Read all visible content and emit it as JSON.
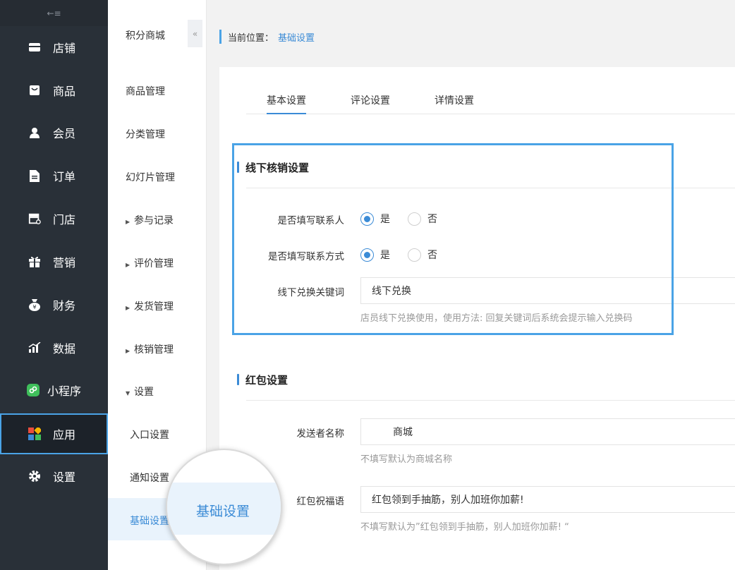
{
  "sidebar": {
    "toggle_icon": "←≡",
    "items": [
      {
        "label": "店铺",
        "icon": "store-icon"
      },
      {
        "label": "商品",
        "icon": "goods-icon"
      },
      {
        "label": "会员",
        "icon": "member-icon"
      },
      {
        "label": "订单",
        "icon": "order-icon"
      },
      {
        "label": "门店",
        "icon": "shop-icon"
      },
      {
        "label": "营销",
        "icon": "gift-icon"
      },
      {
        "label": "财务",
        "icon": "finance-icon"
      },
      {
        "label": "数据",
        "icon": "data-icon"
      },
      {
        "label": "小程序",
        "icon": "miniprogram-icon"
      },
      {
        "label": "应用",
        "icon": "apps-icon",
        "active": true
      },
      {
        "label": "设置",
        "icon": "gear-icon"
      }
    ]
  },
  "submenu": {
    "title": "积分商城",
    "collapse_icon": "«",
    "items": [
      {
        "label": "商品管理"
      },
      {
        "label": "分类管理"
      },
      {
        "label": "幻灯片管理"
      },
      {
        "label": "参与记录",
        "arrow": "▶"
      },
      {
        "label": "评价管理",
        "arrow": "▶"
      },
      {
        "label": "发货管理",
        "arrow": "▶"
      },
      {
        "label": "核销管理",
        "arrow": "▶"
      },
      {
        "label": "设置",
        "arrow": "▼"
      },
      {
        "label": "入口设置"
      },
      {
        "label": "通知设置"
      },
      {
        "label": "基础设置",
        "active": true
      }
    ],
    "magnifier_label": "基础设置"
  },
  "breadcrumb": {
    "prefix": "当前位置：",
    "current": "基础设置"
  },
  "tabs": [
    "基本设置",
    "评论设置",
    "详情设置"
  ],
  "offline": {
    "title": "线下核销设置",
    "contact_person_label": "是否填写联系人",
    "contact_method_label": "是否填写联系方式",
    "yes": "是",
    "no": "否",
    "keyword_label": "线下兑换关键词",
    "keyword_value": "线下兑换",
    "keyword_hint": "店员线下兑换使用，使用方法: 回复关键词后系统会提示输入兑换码"
  },
  "redpacket": {
    "title": "红包设置",
    "sender_label": "发送者名称",
    "sender_value": "商城",
    "sender_hint": "不填写默认为商城名称",
    "wish_label": "红包祝福语",
    "wish_value": "红包领到手抽筋，别人加班你加薪!",
    "wish_hint": "不填写默认为”红包领到手抽筋，别人加班你加薪! “"
  },
  "colors": {
    "accent": "#3b8bd6",
    "sidebar_bg": "#293038",
    "highlight": "#4aa3e6"
  }
}
